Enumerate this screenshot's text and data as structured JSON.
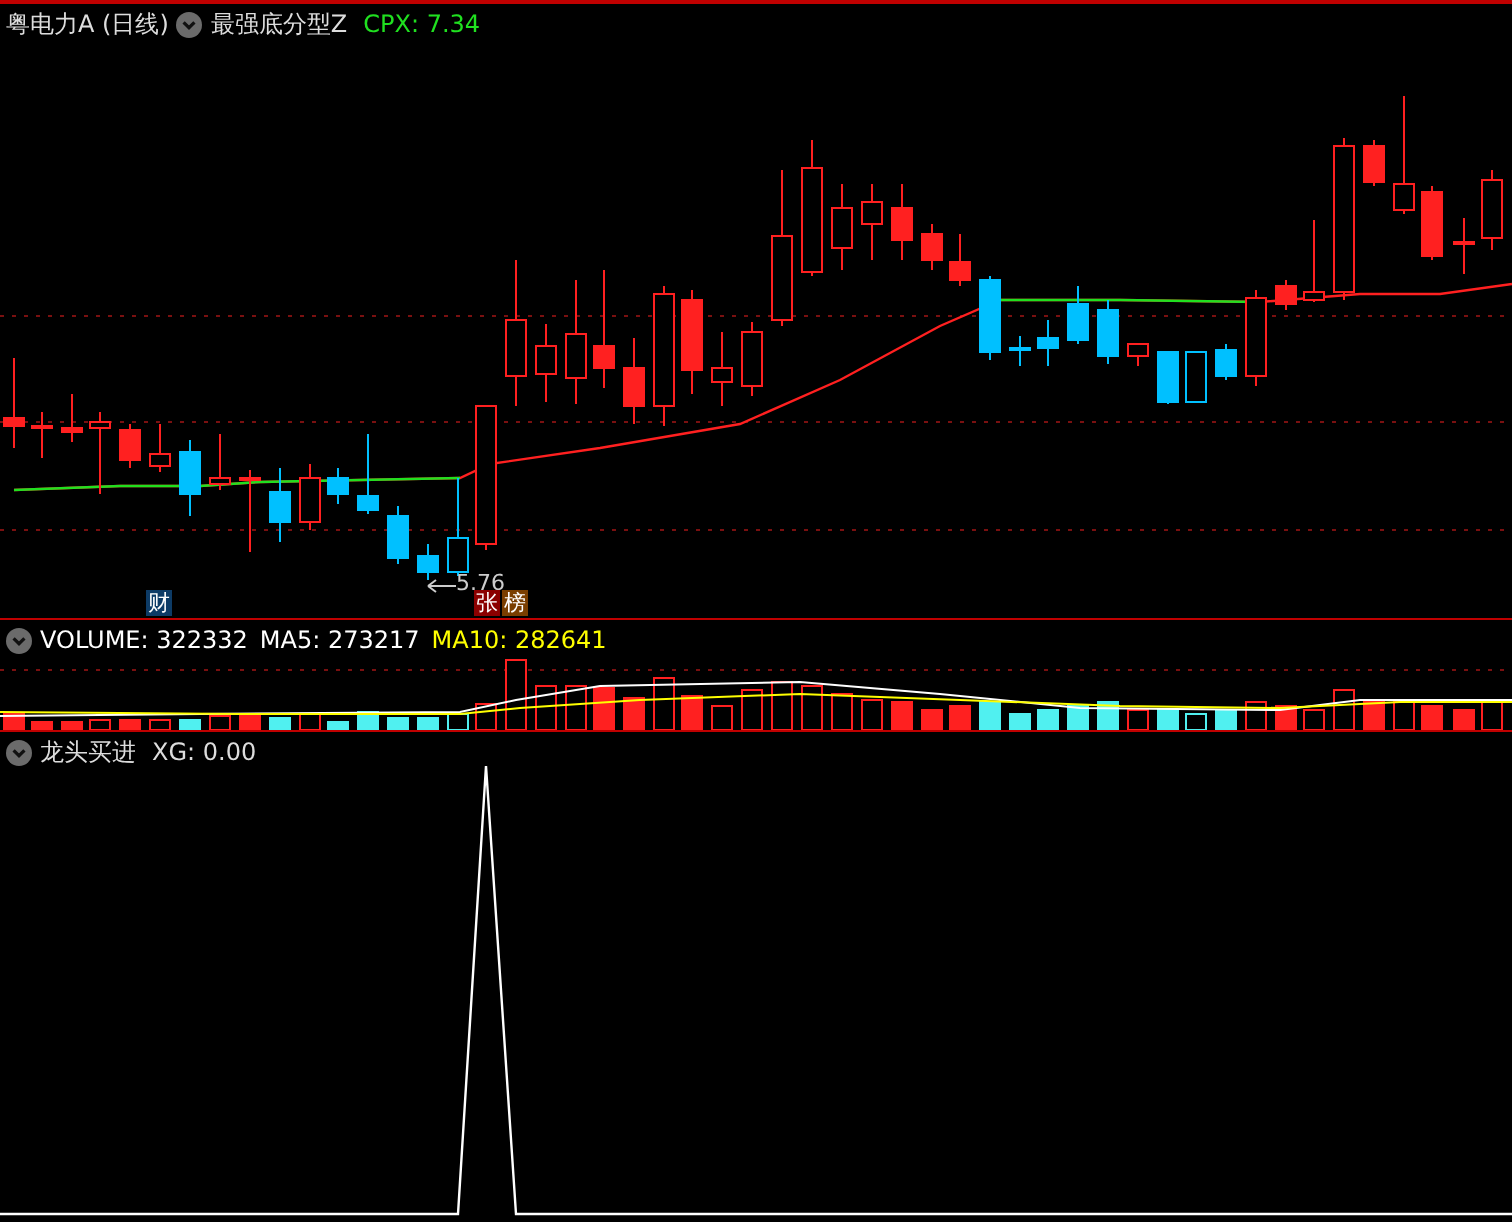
{
  "price_panel": {
    "title": "粤电力A (日线)",
    "indicator": "最强底分型Z",
    "reading": "CPX: 7.34",
    "low_marker": "5.76",
    "badges": [
      {
        "text": "财",
        "kind": "finance"
      },
      {
        "text": "张",
        "kind": "limit"
      },
      {
        "text": "榜",
        "kind": "list"
      }
    ]
  },
  "volume_panel": {
    "readings": [
      {
        "text": "VOLUME: 322332",
        "kind": "volume"
      },
      {
        "text": "MA5: 273217",
        "kind": "ma5"
      },
      {
        "text": "MA10: 282641",
        "kind": "ma10"
      }
    ]
  },
  "signal_panel": {
    "title": "龙头买进",
    "reading": "XG: 0.00"
  }
}
